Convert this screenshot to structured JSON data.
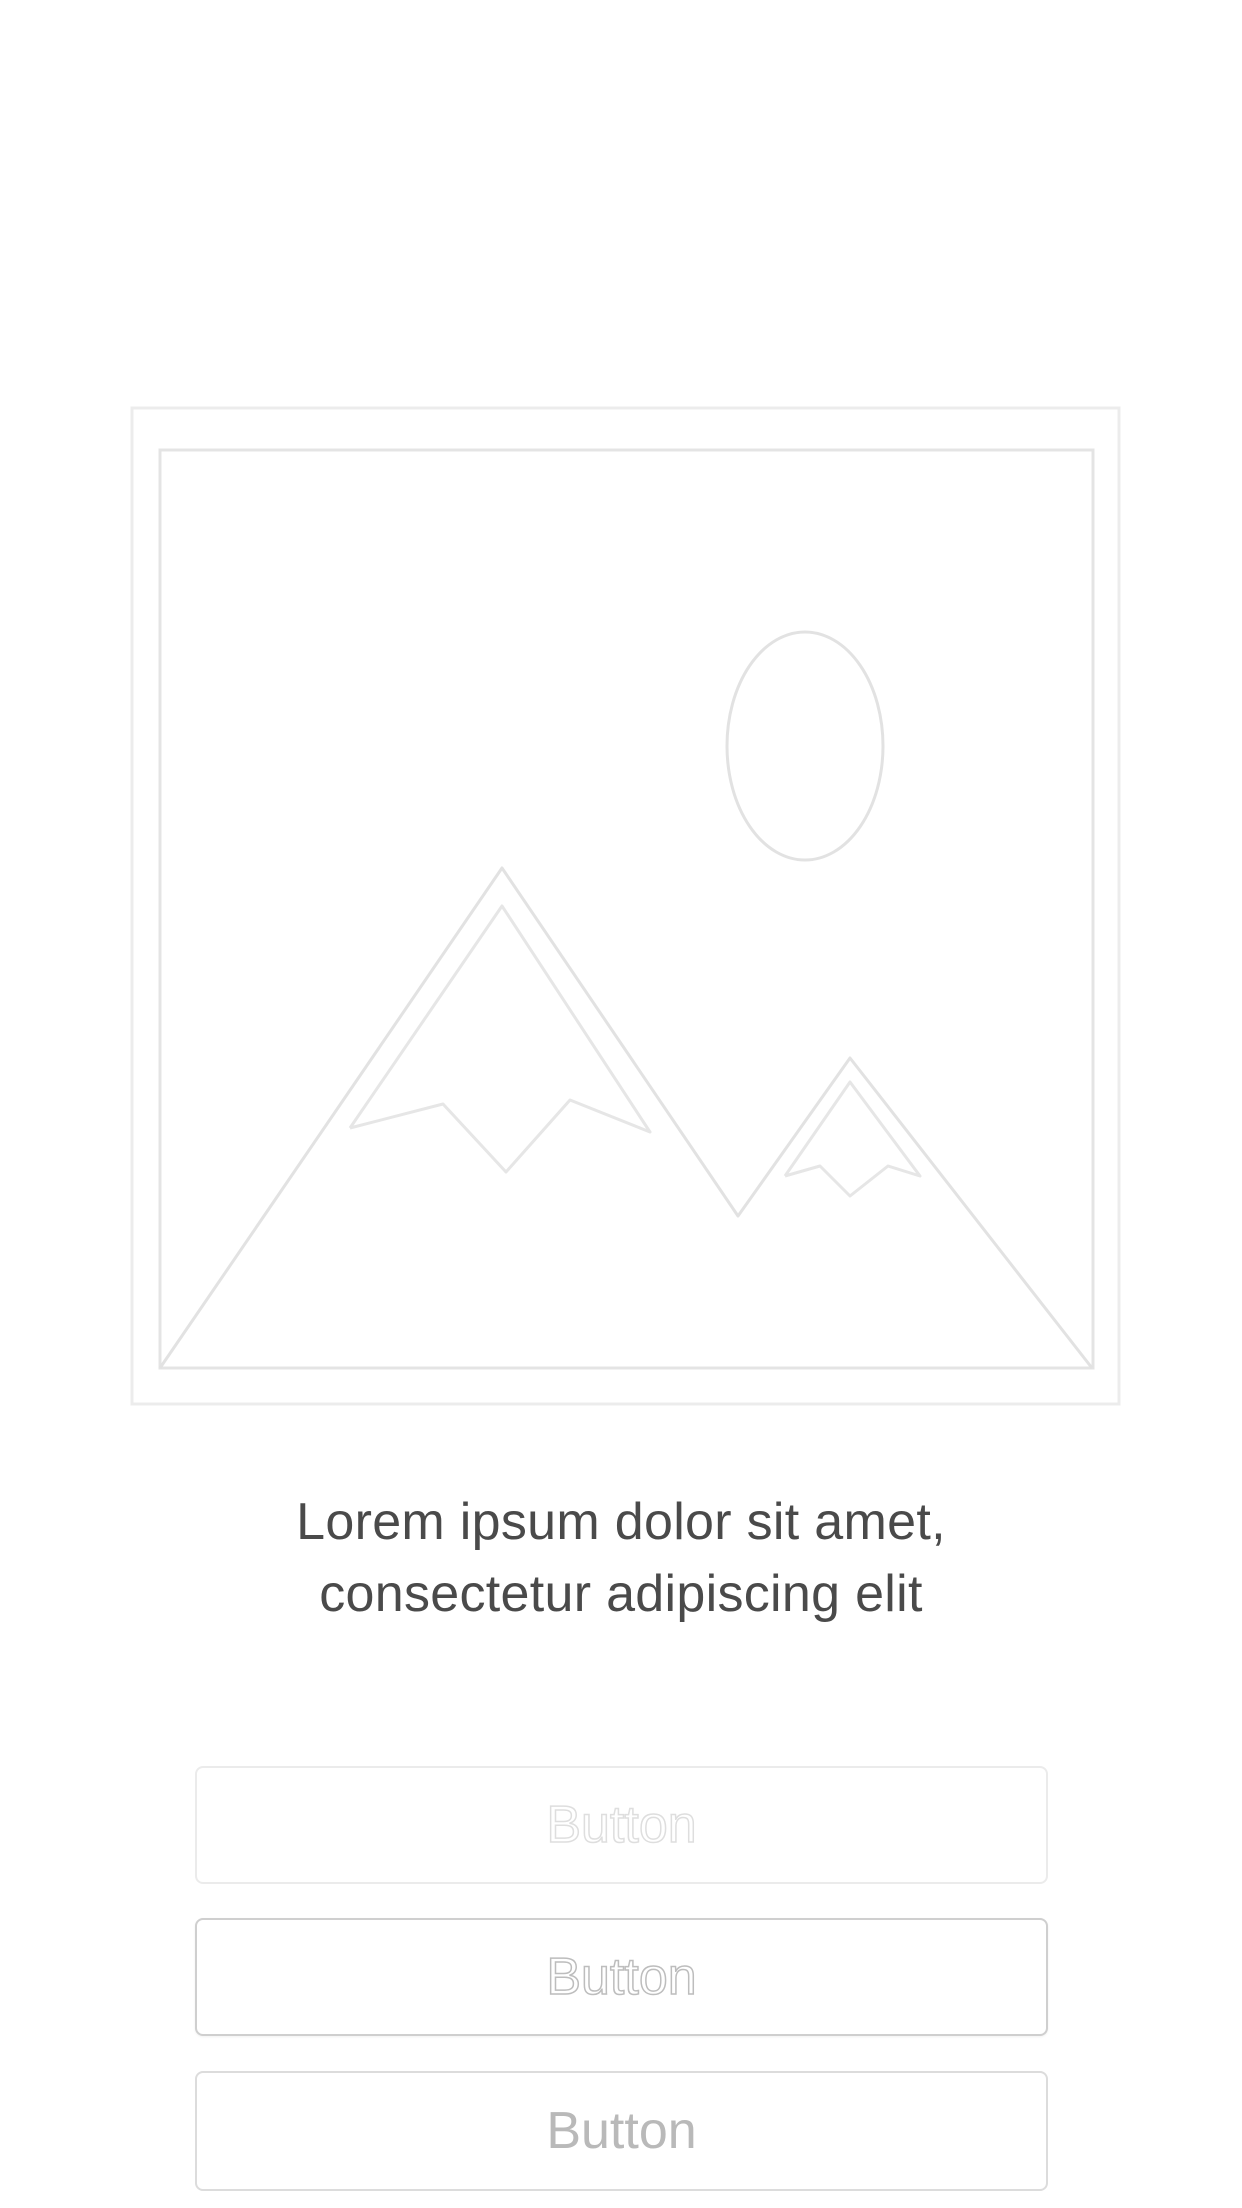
{
  "caption": {
    "line1": "Lorem ipsum dolor sit amet,",
    "line2": "consectetur adipiscing elit"
  },
  "image": {
    "icon": "image-placeholder-icon"
  },
  "buttons": [
    {
      "label": "Button",
      "style": "ghost-light"
    },
    {
      "label": "Button",
      "style": "outlined"
    },
    {
      "label": "Button",
      "style": "outlined-text"
    }
  ],
  "colors": {
    "background": "#ffffff",
    "caption_text": "#4a4a4a",
    "line_art": "#e6e6e6",
    "button_border_light": "#ebebeb",
    "button_border": "#cfcfcf",
    "button_text_muted": "#b9b9b9"
  }
}
